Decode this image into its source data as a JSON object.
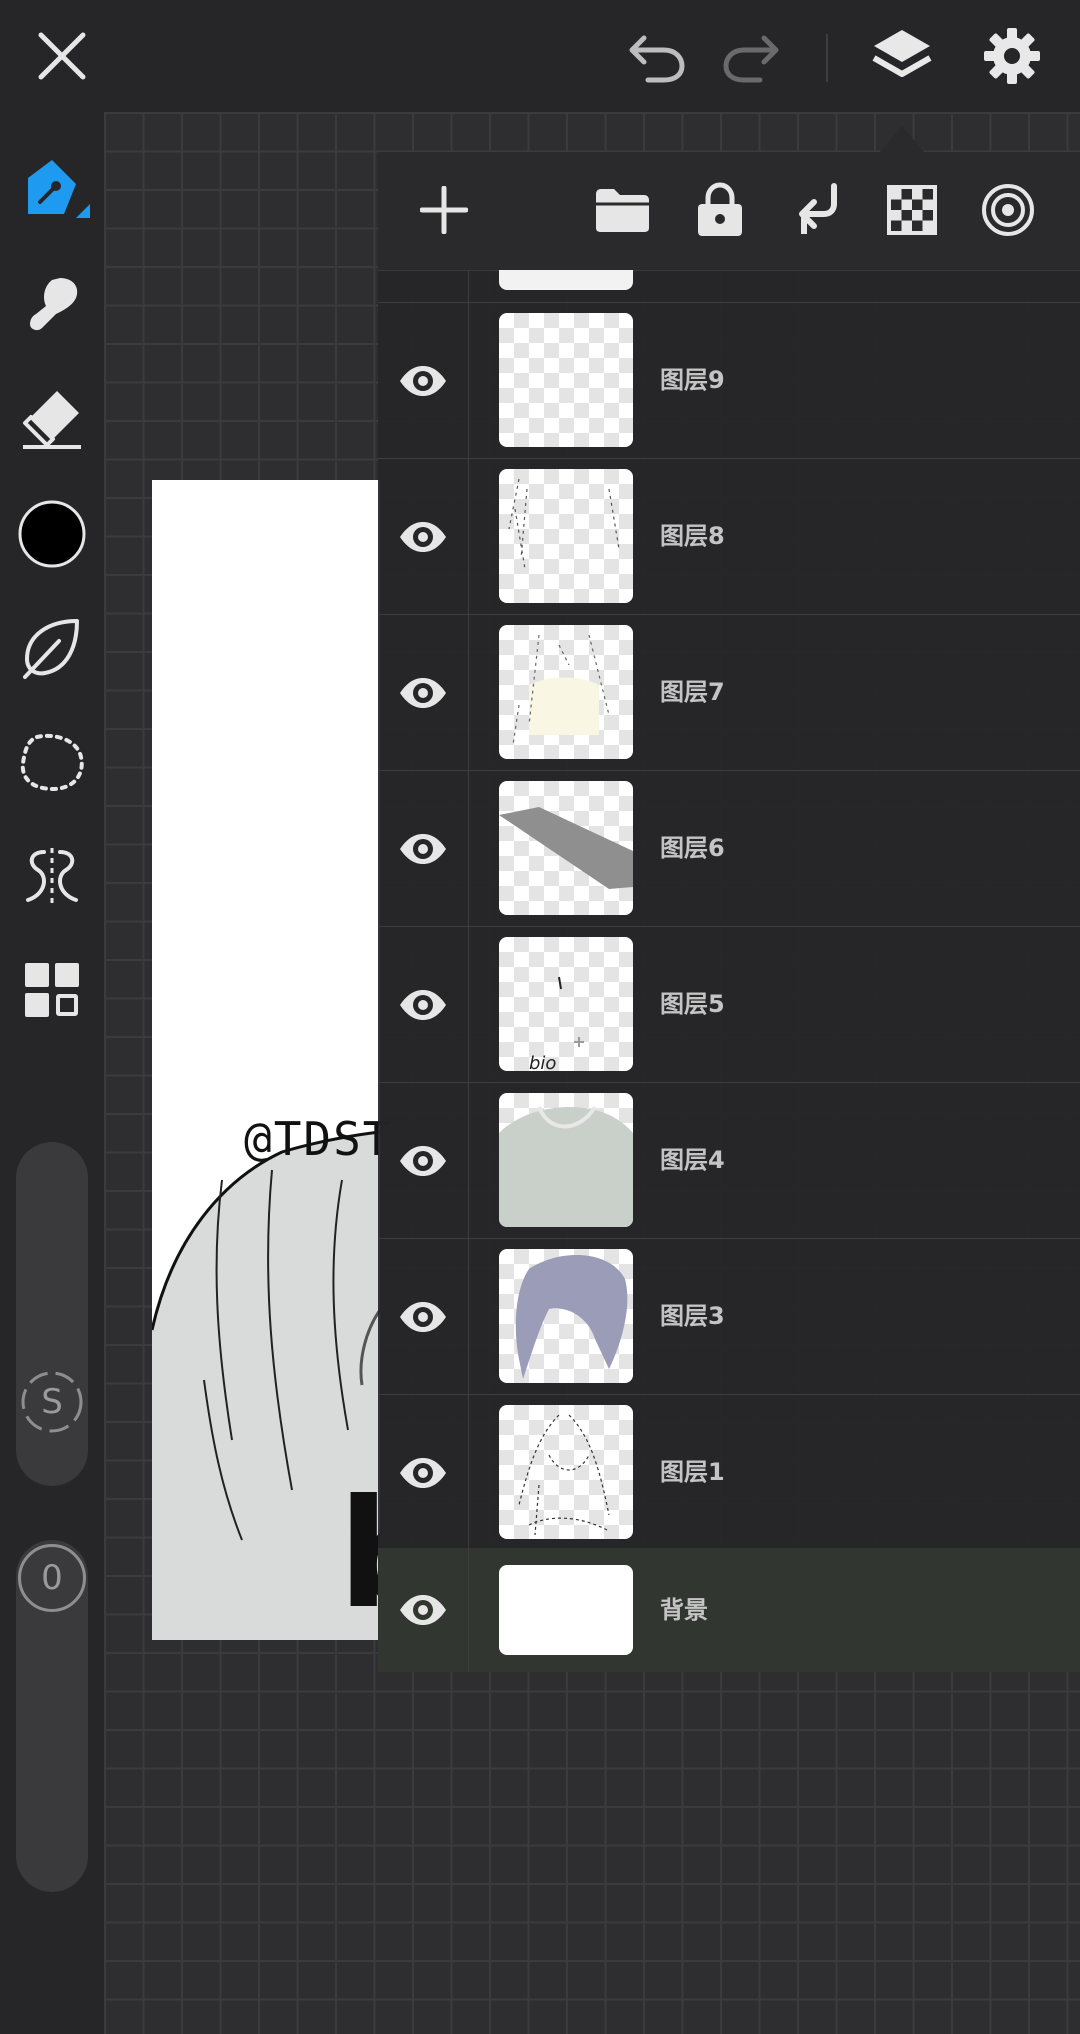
{
  "layers_panel": {
    "rows": [
      {
        "name": "图层9"
      },
      {
        "name": "图层8"
      },
      {
        "name": "图层7"
      },
      {
        "name": "图层6"
      },
      {
        "name": "图层5"
      },
      {
        "name": "图层4"
      },
      {
        "name": "图层3"
      },
      {
        "name": "图层1"
      }
    ],
    "background_layer": {
      "name": "背景"
    }
  },
  "canvas": {
    "watermark_text": "@TDST",
    "shirt_letter": "b",
    "thumb_text": "bio"
  },
  "sidebar": {
    "brush_size_badge": "S",
    "opacity_badge": "0"
  },
  "colors": {
    "accent": "#1e9bf0",
    "current_color": "#000000",
    "panel_bg": "#262628",
    "selected_row_bg": "#323631"
  },
  "icons": {
    "top": [
      "close-icon",
      "undo-icon",
      "redo-icon",
      "layers-icon",
      "settings-icon"
    ],
    "left": [
      "pen-icon",
      "smudge-icon",
      "eraser-icon",
      "color-icon",
      "leaf-icon",
      "lasso-icon",
      "symmetry-icon",
      "grid-icon"
    ],
    "panel": [
      "add-layer-icon",
      "folder-icon",
      "lock-icon",
      "merge-down-icon",
      "transparency-icon",
      "target-icon",
      "eye-icon"
    ]
  }
}
